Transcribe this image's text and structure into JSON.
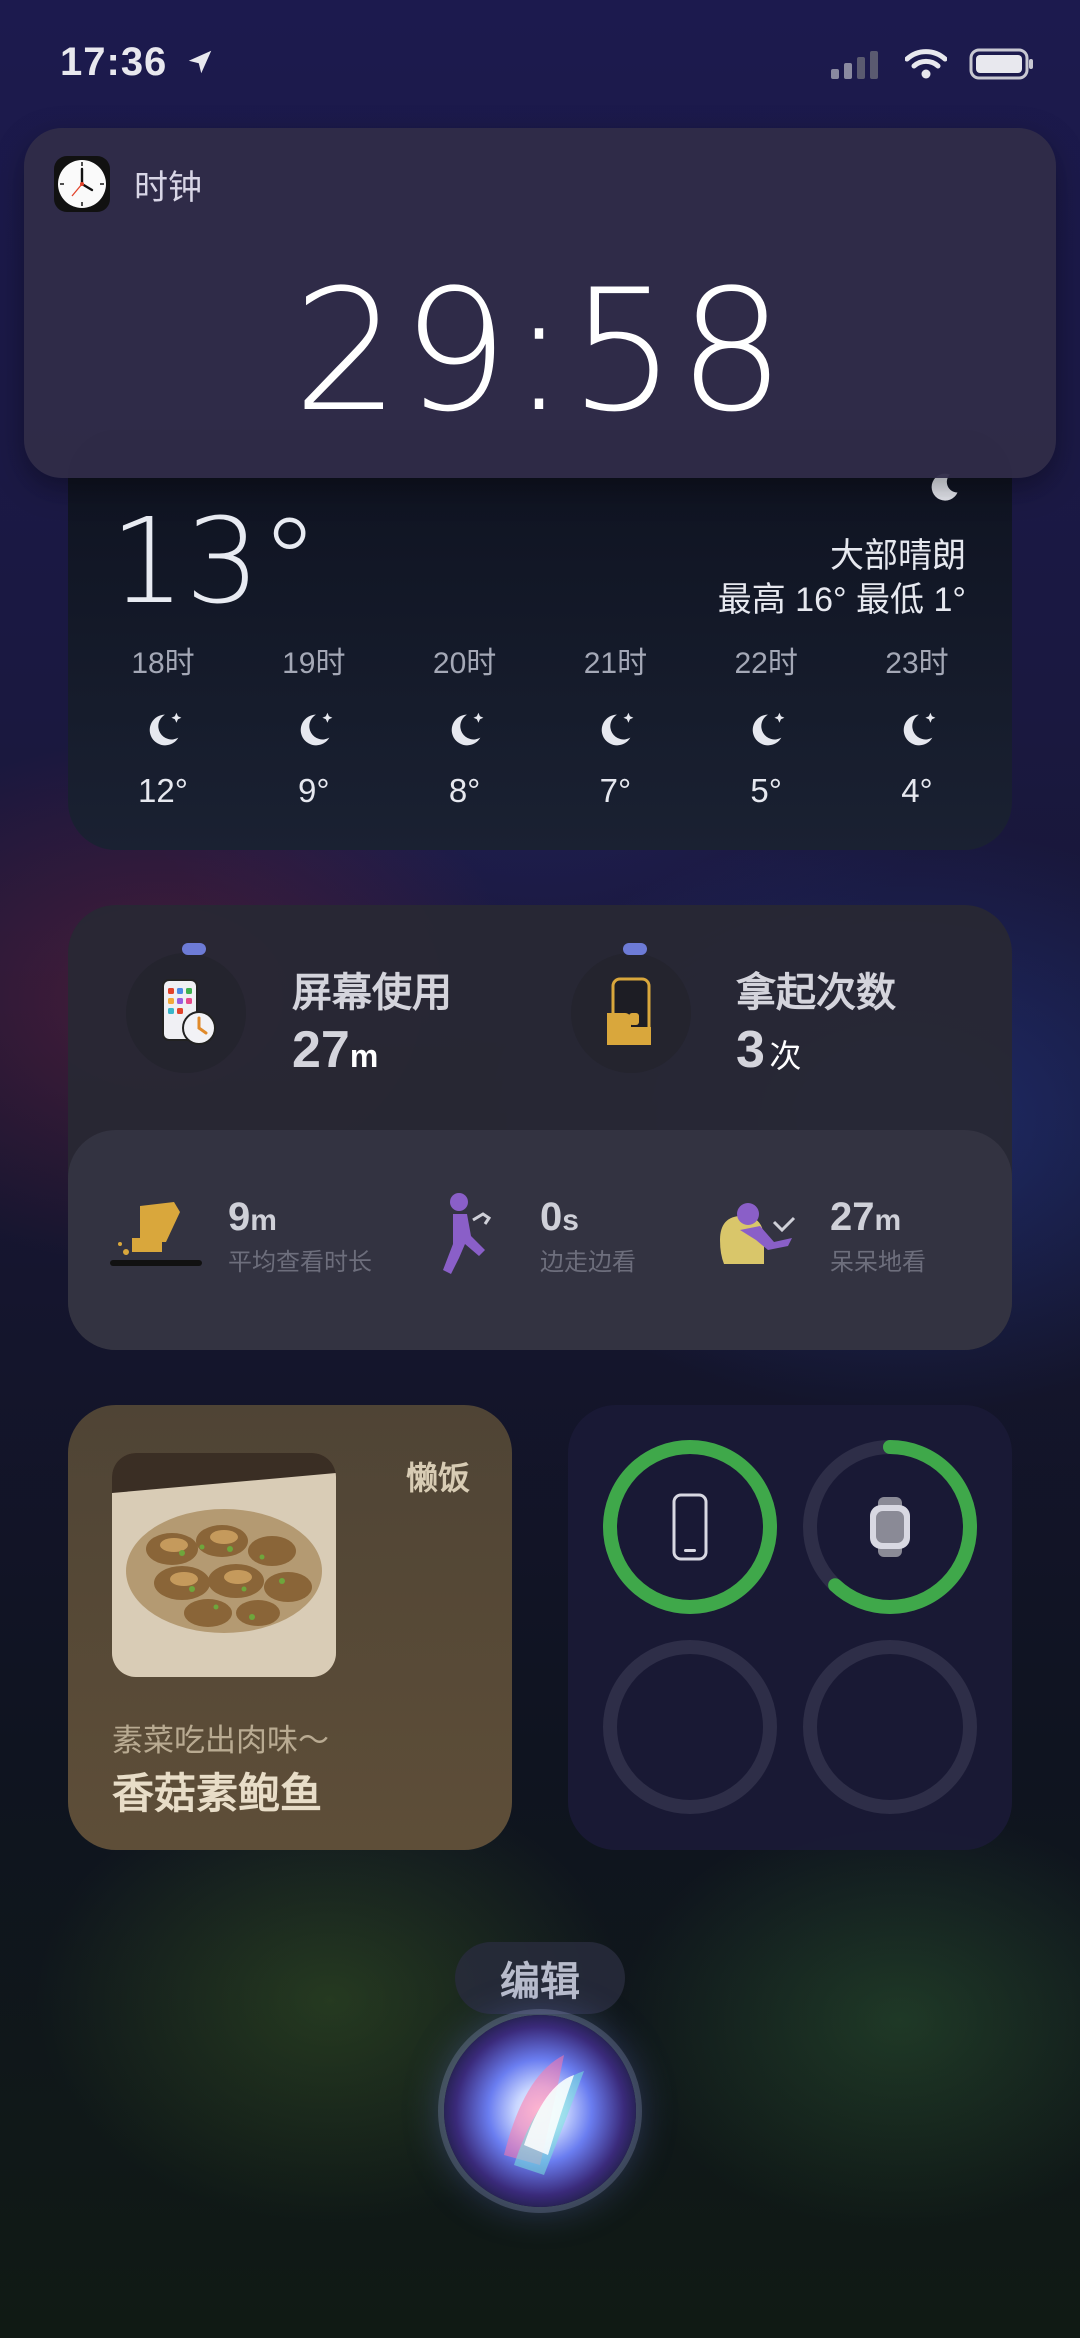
{
  "status_bar": {
    "time": "17:36"
  },
  "clock_notification": {
    "app_name": "时钟",
    "timer": "29:58"
  },
  "weather": {
    "temperature": "13°",
    "condition": "大部晴朗",
    "range": "最高 16° 最低 1°",
    "hourly": [
      {
        "hour": "18时",
        "temp": "12°"
      },
      {
        "hour": "19时",
        "temp": "9°"
      },
      {
        "hour": "20时",
        "temp": "8°"
      },
      {
        "hour": "21时",
        "temp": "7°"
      },
      {
        "hour": "22时",
        "temp": "5°"
      },
      {
        "hour": "23时",
        "temp": "4°"
      }
    ]
  },
  "screen_time": {
    "usage_label": "屏幕使用",
    "usage_value": "27",
    "usage_unit": "m",
    "pickups_label": "拿起次数",
    "pickups_value": "3",
    "pickups_unit": "次",
    "stats": [
      {
        "value": "9",
        "unit": "m",
        "label": "平均查看时长"
      },
      {
        "value": "0",
        "unit": "s",
        "label": "边走边看"
      },
      {
        "value": "27",
        "unit": "m",
        "label": "呆呆地看"
      }
    ]
  },
  "recipe": {
    "brand": "懒饭",
    "subtitle": "素菜吃出肉味～",
    "title": "香菇素鲍鱼"
  },
  "batteries": [
    {
      "device": "iphone",
      "level": 1.0,
      "color": "#3fa84a"
    },
    {
      "device": "watch",
      "level": 0.62,
      "color": "#3fa84a"
    },
    {
      "device": "empty",
      "level": 0
    },
    {
      "device": "empty",
      "level": 0
    }
  ],
  "edit_label": "编辑"
}
